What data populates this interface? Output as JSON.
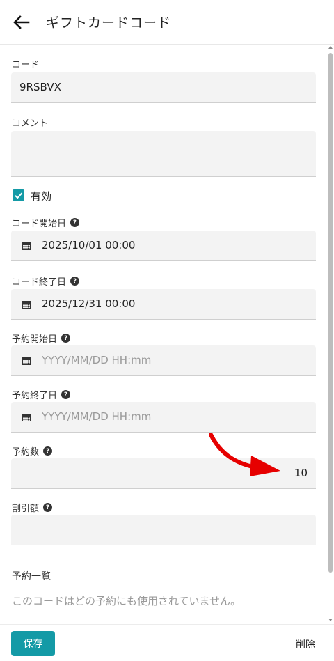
{
  "header": {
    "title": "ギフトカードコード",
    "back_icon": "arrow-left-icon"
  },
  "form": {
    "code": {
      "label": "コード",
      "value": "9RSBVX"
    },
    "comment": {
      "label": "コメント",
      "value": ""
    },
    "enabled": {
      "label": "有効",
      "checked": true
    },
    "code_start": {
      "label": "コード開始日",
      "value": "2025/10/01 00:00"
    },
    "code_end": {
      "label": "コード終了日",
      "value": "2025/12/31 00:00"
    },
    "reserve_start": {
      "label": "予約開始日",
      "placeholder": "YYYY/MM/DD HH:mm"
    },
    "reserve_end": {
      "label": "予約終了日",
      "placeholder": "YYYY/MM/DD HH:mm"
    },
    "reserve_count": {
      "label": "予約数",
      "value": "10"
    },
    "discount": {
      "label": "割引額",
      "value": ""
    }
  },
  "reservations": {
    "title": "予約一覧",
    "empty_note": "このコードはどの予約にも使用されていません。"
  },
  "footer": {
    "save_label": "保存",
    "delete_label": "削除"
  },
  "colors": {
    "accent": "#149aa6",
    "annotation_arrow": "#e60000"
  }
}
